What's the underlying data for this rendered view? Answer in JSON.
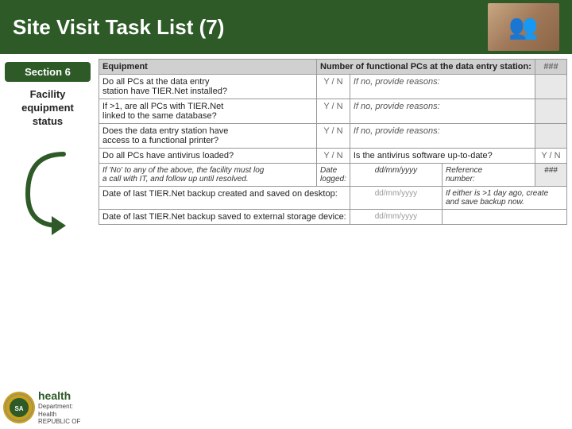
{
  "header": {
    "title": "Site Visit Task List (7)"
  },
  "sidebar": {
    "section_label": "Section 6",
    "section_sublabel": "Facility\nequipment\nstatus"
  },
  "footer": {
    "logo_text": "SA",
    "health_text": "health",
    "dept_text": "Department:\nHealth\nREPUBLIC OF"
  },
  "table": {
    "header_row": {
      "col1": "Equipment",
      "col2": "Number of functional PCs at the data entry station:",
      "col3": "###"
    },
    "rows": [
      {
        "question": "Do all PCs at the data entry station have TIER.Net installed?",
        "yn": "Y / N",
        "reason_label": "If no, provide reasons:",
        "reason_value": ""
      },
      {
        "question": "If >1, are all PCs with TIER.Net linked to the same database?",
        "yn": "Y / N",
        "reason_label": "If no, provide reasons:",
        "reason_value": ""
      },
      {
        "question": "Does the data entry station have access to a functional printer?",
        "yn": "Y / N",
        "reason_label": "If no, provide reasons:",
        "reason_value": ""
      },
      {
        "question": "Do all PCs have antivirus loaded?",
        "yn": "Y / N",
        "antivirus_label": "Is the antivirus software up-to-date?",
        "antivirus_yn": "Y / N"
      }
    ],
    "italic_row": {
      "text": "If 'No' to any of the above, the facility must log a call with IT, and follow up until resolved.",
      "date_label": "Date logged:",
      "date_placeholder": "dd/mm/yyyy",
      "ref_label": "Reference number:",
      "ref_value": "###"
    },
    "backup_row1": {
      "label": "Date of last TIER.Net backup created and saved on desktop:",
      "date_placeholder": "dd/mm/yyyy",
      "note": "If either is >1 day ago, create and save backup now."
    },
    "backup_row2": {
      "label": "Date of last TIER.Net backup saved to external storage device:",
      "date_placeholder": "dd/mm/yyyy"
    }
  }
}
